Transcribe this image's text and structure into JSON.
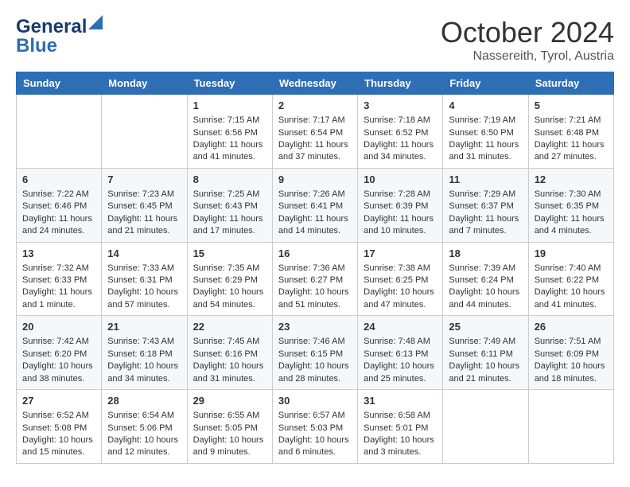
{
  "header": {
    "logo_line1": "General",
    "logo_line2": "Blue",
    "month": "October 2024",
    "location": "Nassereith, Tyrol, Austria"
  },
  "days_of_week": [
    "Sunday",
    "Monday",
    "Tuesday",
    "Wednesday",
    "Thursday",
    "Friday",
    "Saturday"
  ],
  "weeks": [
    [
      {
        "day": "",
        "info": ""
      },
      {
        "day": "",
        "info": ""
      },
      {
        "day": "1",
        "info": "Sunrise: 7:15 AM\nSunset: 6:56 PM\nDaylight: 11 hours and 41 minutes."
      },
      {
        "day": "2",
        "info": "Sunrise: 7:17 AM\nSunset: 6:54 PM\nDaylight: 11 hours and 37 minutes."
      },
      {
        "day": "3",
        "info": "Sunrise: 7:18 AM\nSunset: 6:52 PM\nDaylight: 11 hours and 34 minutes."
      },
      {
        "day": "4",
        "info": "Sunrise: 7:19 AM\nSunset: 6:50 PM\nDaylight: 11 hours and 31 minutes."
      },
      {
        "day": "5",
        "info": "Sunrise: 7:21 AM\nSunset: 6:48 PM\nDaylight: 11 hours and 27 minutes."
      }
    ],
    [
      {
        "day": "6",
        "info": "Sunrise: 7:22 AM\nSunset: 6:46 PM\nDaylight: 11 hours and 24 minutes."
      },
      {
        "day": "7",
        "info": "Sunrise: 7:23 AM\nSunset: 6:45 PM\nDaylight: 11 hours and 21 minutes."
      },
      {
        "day": "8",
        "info": "Sunrise: 7:25 AM\nSunset: 6:43 PM\nDaylight: 11 hours and 17 minutes."
      },
      {
        "day": "9",
        "info": "Sunrise: 7:26 AM\nSunset: 6:41 PM\nDaylight: 11 hours and 14 minutes."
      },
      {
        "day": "10",
        "info": "Sunrise: 7:28 AM\nSunset: 6:39 PM\nDaylight: 11 hours and 10 minutes."
      },
      {
        "day": "11",
        "info": "Sunrise: 7:29 AM\nSunset: 6:37 PM\nDaylight: 11 hours and 7 minutes."
      },
      {
        "day": "12",
        "info": "Sunrise: 7:30 AM\nSunset: 6:35 PM\nDaylight: 11 hours and 4 minutes."
      }
    ],
    [
      {
        "day": "13",
        "info": "Sunrise: 7:32 AM\nSunset: 6:33 PM\nDaylight: 11 hours and 1 minute."
      },
      {
        "day": "14",
        "info": "Sunrise: 7:33 AM\nSunset: 6:31 PM\nDaylight: 10 hours and 57 minutes."
      },
      {
        "day": "15",
        "info": "Sunrise: 7:35 AM\nSunset: 6:29 PM\nDaylight: 10 hours and 54 minutes."
      },
      {
        "day": "16",
        "info": "Sunrise: 7:36 AM\nSunset: 6:27 PM\nDaylight: 10 hours and 51 minutes."
      },
      {
        "day": "17",
        "info": "Sunrise: 7:38 AM\nSunset: 6:25 PM\nDaylight: 10 hours and 47 minutes."
      },
      {
        "day": "18",
        "info": "Sunrise: 7:39 AM\nSunset: 6:24 PM\nDaylight: 10 hours and 44 minutes."
      },
      {
        "day": "19",
        "info": "Sunrise: 7:40 AM\nSunset: 6:22 PM\nDaylight: 10 hours and 41 minutes."
      }
    ],
    [
      {
        "day": "20",
        "info": "Sunrise: 7:42 AM\nSunset: 6:20 PM\nDaylight: 10 hours and 38 minutes."
      },
      {
        "day": "21",
        "info": "Sunrise: 7:43 AM\nSunset: 6:18 PM\nDaylight: 10 hours and 34 minutes."
      },
      {
        "day": "22",
        "info": "Sunrise: 7:45 AM\nSunset: 6:16 PM\nDaylight: 10 hours and 31 minutes."
      },
      {
        "day": "23",
        "info": "Sunrise: 7:46 AM\nSunset: 6:15 PM\nDaylight: 10 hours and 28 minutes."
      },
      {
        "day": "24",
        "info": "Sunrise: 7:48 AM\nSunset: 6:13 PM\nDaylight: 10 hours and 25 minutes."
      },
      {
        "day": "25",
        "info": "Sunrise: 7:49 AM\nSunset: 6:11 PM\nDaylight: 10 hours and 21 minutes."
      },
      {
        "day": "26",
        "info": "Sunrise: 7:51 AM\nSunset: 6:09 PM\nDaylight: 10 hours and 18 minutes."
      }
    ],
    [
      {
        "day": "27",
        "info": "Sunrise: 6:52 AM\nSunset: 5:08 PM\nDaylight: 10 hours and 15 minutes."
      },
      {
        "day": "28",
        "info": "Sunrise: 6:54 AM\nSunset: 5:06 PM\nDaylight: 10 hours and 12 minutes."
      },
      {
        "day": "29",
        "info": "Sunrise: 6:55 AM\nSunset: 5:05 PM\nDaylight: 10 hours and 9 minutes."
      },
      {
        "day": "30",
        "info": "Sunrise: 6:57 AM\nSunset: 5:03 PM\nDaylight: 10 hours and 6 minutes."
      },
      {
        "day": "31",
        "info": "Sunrise: 6:58 AM\nSunset: 5:01 PM\nDaylight: 10 hours and 3 minutes."
      },
      {
        "day": "",
        "info": ""
      },
      {
        "day": "",
        "info": ""
      }
    ]
  ]
}
